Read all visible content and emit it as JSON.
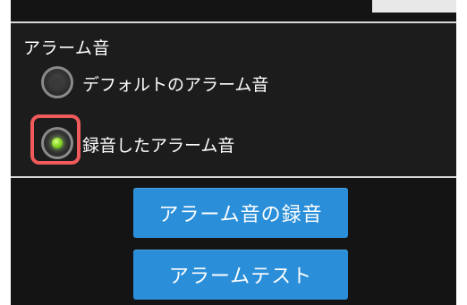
{
  "section": {
    "title": "アラーム音"
  },
  "options": [
    {
      "label": "デフォルトのアラーム音",
      "selected": false
    },
    {
      "label": "録音したアラーム音",
      "selected": true
    }
  ],
  "buttons": {
    "record_label": "アラーム音の録音",
    "test_label": "アラームテスト"
  },
  "colors": {
    "background": "#1c1c1c",
    "button": "#2a8ed8",
    "selected_dot": "#7ed321",
    "highlight": "#f05a5a"
  }
}
